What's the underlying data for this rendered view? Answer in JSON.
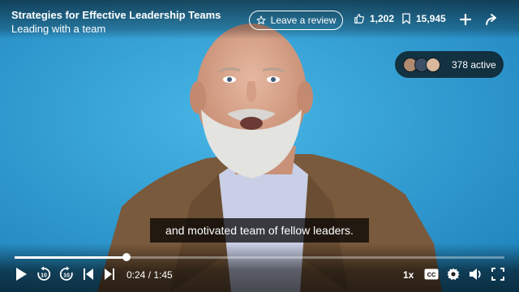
{
  "header": {
    "course_title": "Strategies for Effective Leadership Teams",
    "video_title": "Leading with a team",
    "review_label": "Leave a review",
    "likes": "1,202",
    "saves": "15,945"
  },
  "presence": {
    "active_label": "378 active"
  },
  "caption": {
    "text": "and motivated team of fellow leaders."
  },
  "playback": {
    "time_display": "0:24 / 1:45",
    "progress_fraction": 0.2286,
    "speed": "1x"
  },
  "icons": {
    "like": "thumbs-up-icon",
    "save": "bookmark-icon",
    "add": "plus-icon",
    "share": "share-arrow-icon",
    "review": "star-icon",
    "play": "play-icon",
    "rewind": "rewind-10-icon",
    "forward": "forward-10-icon",
    "prev": "skip-previous-icon",
    "next": "skip-next-icon",
    "cc": "closed-captions-icon",
    "settings": "gear-icon",
    "volume": "volume-icon",
    "fullscreen": "fullscreen-icon"
  },
  "colors": {
    "backdrop": "#2f9bd2",
    "overlay": "#0a141a",
    "text": "#ffffff"
  }
}
